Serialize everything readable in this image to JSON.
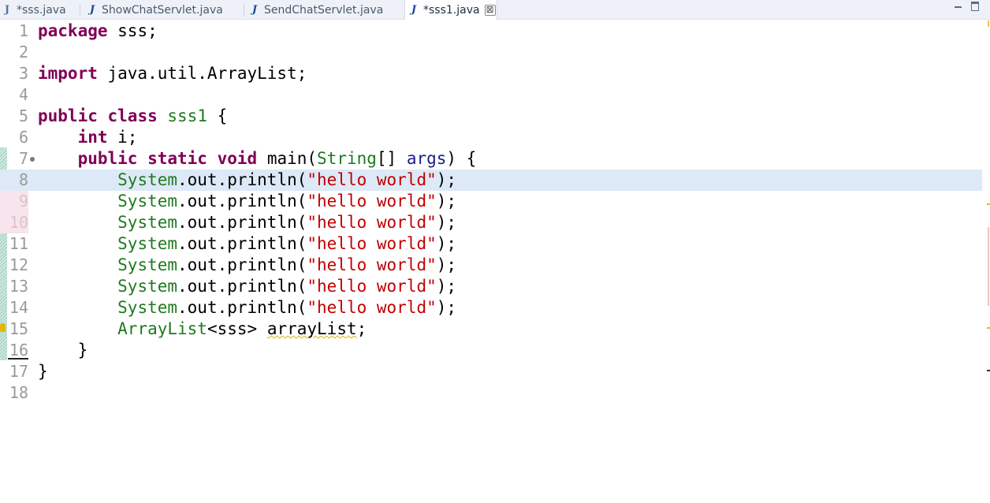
{
  "tabs": [
    {
      "label": "*sss.java",
      "icon": "java-file-icon",
      "active": false
    },
    {
      "label": "ShowChatServlet.java",
      "icon": "java-file-icon",
      "active": false
    },
    {
      "label": "SendChatServlet.java",
      "icon": "java-file-icon",
      "active": false
    },
    {
      "label": "*sss1.java",
      "icon": "java-file-icon",
      "active": true,
      "close_glyph": "⊠"
    }
  ],
  "window_controls": {
    "minimize": "minimize-icon",
    "maximize": "maximize-icon"
  },
  "editor": {
    "current_line": 8,
    "lines": [
      {
        "n": "1",
        "tokens": [
          [
            "kw",
            "package"
          ],
          [
            "",
            "  sss;"
          ]
        ]
      },
      {
        "n": "2",
        "tokens": []
      },
      {
        "n": "3",
        "tokens": [
          [
            "kw",
            "import"
          ],
          [
            "",
            " java.util.ArrayList;"
          ]
        ]
      },
      {
        "n": "4",
        "tokens": []
      },
      {
        "n": "5",
        "tokens": [
          [
            "kw",
            "public"
          ],
          [
            "",
            " "
          ],
          [
            "kw",
            "class"
          ],
          [
            "",
            " "
          ],
          [
            "ty",
            "sss1"
          ],
          [
            "",
            " {"
          ]
        ]
      },
      {
        "n": "6",
        "tokens": [
          [
            "",
            "    "
          ],
          [
            "kw",
            "int"
          ],
          [
            "",
            " i;"
          ]
        ]
      },
      {
        "n": "7",
        "tokens": [
          [
            "",
            "    "
          ],
          [
            "kw",
            "public"
          ],
          [
            "",
            " "
          ],
          [
            "kw",
            "static"
          ],
          [
            "",
            " "
          ],
          [
            "kw",
            "void"
          ],
          [
            "",
            " main("
          ],
          [
            "ty",
            "String"
          ],
          [
            "",
            "[] "
          ],
          [
            "var",
            "args"
          ],
          [
            "",
            ") {"
          ]
        ]
      },
      {
        "n": "8",
        "tokens": [
          [
            "",
            "        "
          ],
          [
            "ty",
            "System"
          ],
          [
            "",
            ".out.println("
          ],
          [
            "str",
            "\"hello world\""
          ],
          [
            "",
            ");"
          ]
        ]
      },
      {
        "n": "9",
        "tokens": [
          [
            "",
            "        "
          ],
          [
            "ty",
            "System"
          ],
          [
            "",
            ".out.println("
          ],
          [
            "str",
            "\"hello world\""
          ],
          [
            "",
            ");"
          ]
        ]
      },
      {
        "n": "10",
        "tokens": [
          [
            "",
            "        "
          ],
          [
            "ty",
            "System"
          ],
          [
            "",
            ".out.println("
          ],
          [
            "str",
            "\"hello world\""
          ],
          [
            "",
            ");"
          ]
        ]
      },
      {
        "n": "11",
        "tokens": [
          [
            "",
            "        "
          ],
          [
            "ty",
            "System"
          ],
          [
            "",
            ".out.println("
          ],
          [
            "str",
            "\"hello world\""
          ],
          [
            "",
            ");"
          ]
        ]
      },
      {
        "n": "12",
        "tokens": [
          [
            "",
            "        "
          ],
          [
            "ty",
            "System"
          ],
          [
            "",
            ".out.println("
          ],
          [
            "str",
            "\"hello world\""
          ],
          [
            "",
            ");"
          ]
        ]
      },
      {
        "n": "13",
        "tokens": [
          [
            "",
            "        "
          ],
          [
            "ty",
            "System"
          ],
          [
            "",
            ".out.println("
          ],
          [
            "str",
            "\"hello world\""
          ],
          [
            "",
            ");"
          ]
        ]
      },
      {
        "n": "14",
        "tokens": [
          [
            "",
            "        "
          ],
          [
            "ty",
            "System"
          ],
          [
            "",
            ".out.println("
          ],
          [
            "str",
            "\"hello world\""
          ],
          [
            "",
            ");"
          ]
        ]
      },
      {
        "n": "15",
        "tokens": [
          [
            "",
            "        "
          ],
          [
            "ty",
            "ArrayList"
          ],
          [
            "",
            "<sss> "
          ],
          [
            "warn",
            "arrayList"
          ],
          [
            "",
            ";"
          ]
        ]
      },
      {
        "n": "16",
        "tokens": [
          [
            "",
            "    }"
          ]
        ]
      },
      {
        "n": "17",
        "tokens": [
          [
            "",
            "}"
          ]
        ]
      },
      {
        "n": "18",
        "tokens": []
      }
    ]
  },
  "colors": {
    "keyword": "#7f0055",
    "type": "#1e7a1e",
    "string": "#c00000",
    "current_line_bg": "#dde9f7",
    "warning_underline": "#d9b200"
  }
}
